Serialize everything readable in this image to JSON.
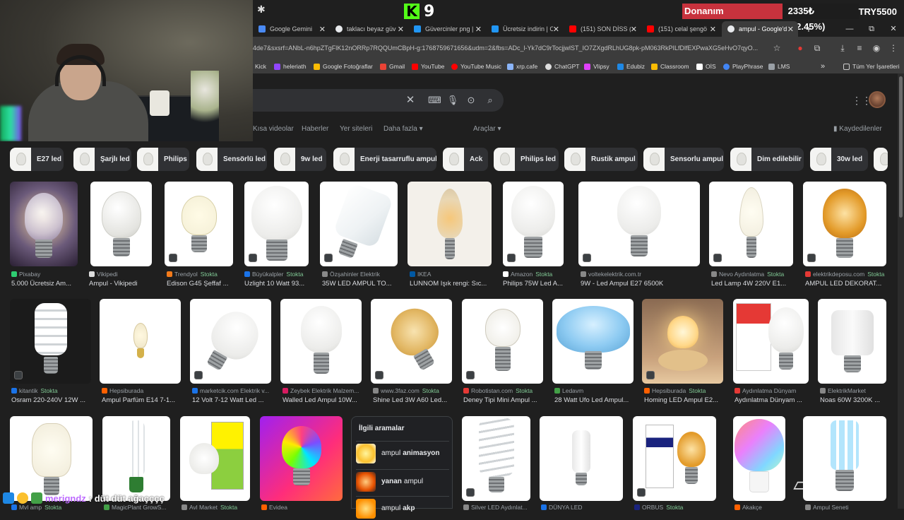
{
  "stream": {
    "kick_count": "9",
    "ticker": {
      "name": "Donanım",
      "change": "2335₺ (42.45%)",
      "price": "TRY5500"
    },
    "chat": {
      "user": "merigndz",
      "message": ": düt düt ağaçççç"
    }
  },
  "browser": {
    "tabs": [
      {
        "title": "Google Gemini",
        "color": "#4a8af4"
      },
      {
        "title": "taklacı beyaz güv",
        "color": "#e8eaed"
      },
      {
        "title": "Güvercinler png |",
        "color": "#2196f3"
      },
      {
        "title": "Ücretsiz indirin | C",
        "color": "#2196f3"
      },
      {
        "title": "(151) SON DİSS (",
        "color": "#ff0000"
      },
      {
        "title": "(151) celal şengö",
        "color": "#ff0000"
      },
      {
        "title": "ampul - Google'd",
        "color": "#e8eaed"
      }
    ],
    "new_tab": "+",
    "window_controls": [
      "⌄",
      "—",
      "⧉",
      "✕"
    ],
    "url": "4de7&sxsrf=ANbL-n6hpZTgFlK12nORRp7RQQUmCBpH-g:1768759671656&udm=2&fbs=ADc_l-Yk7dC9rTocjjwlST_IO7ZXgdRLhUG8pk-pM063RkPILfDlfEXPwaXG5eHvO7qyO...",
    "bookmarks": [
      {
        "label": "Kick",
        "color": "#53fc18"
      },
      {
        "label": "heleriath",
        "color": "#9146ff"
      },
      {
        "label": "Google Fotoğraflar",
        "color": "#fbbc04"
      },
      {
        "label": "Gmail",
        "color": "#ea4335"
      },
      {
        "label": "YouTube",
        "color": "#ff0000"
      },
      {
        "label": "YouTube Music",
        "color": "#ff0000"
      },
      {
        "label": "xrp.cafe",
        "color": "#8ab4f8"
      },
      {
        "label": "ChatGPT",
        "color": "#dddddd"
      },
      {
        "label": "Vlipsy",
        "color": "#e040fb"
      },
      {
        "label": "Edubiz",
        "color": "#1e88e5"
      },
      {
        "label": "Classroom",
        "color": "#fbbc04"
      },
      {
        "label": "OİS",
        "color": "#ffffff"
      },
      {
        "label": "PlayPhrase",
        "color": "#4285f4"
      },
      {
        "label": "LMS",
        "color": "#9aa0a6"
      }
    ],
    "bookmarks_more": "»",
    "all_bookmarks": "Tüm Yer İşaretleri"
  },
  "google": {
    "search_tabs": [
      "Kısa videolar",
      "Haberler",
      "Yer siteleri",
      "Daha fazla ▾",
      "Araçlar ▾"
    ],
    "saved": "Kaydedilenler",
    "chips": [
      "E27 led",
      "Şarjlı led",
      "Philips",
      "Sensörlü led",
      "9w led",
      "Enerji tasarruflu ampul",
      "Ack",
      "Philips led",
      "Rustik ampul",
      "Sensorlu ampul",
      "Dim edilebilir",
      "30w led"
    ],
    "row1": [
      {
        "source": "Pixabay",
        "stock": "",
        "caption": "5.000 Ücretsiz Am...",
        "fav": "#2ecc71"
      },
      {
        "source": "Vikipedi",
        "stock": "",
        "caption": "Ampul - Vikipedi",
        "fav": "#dddddd"
      },
      {
        "source": "Trendyol",
        "stock": "Stokta",
        "caption": "Edison G45 Şeffaf ...",
        "fav": "#f27a1a"
      },
      {
        "source": "Büyükalpler",
        "stock": "Stokta",
        "caption": "Uzlight 10 Watt 93...",
        "fav": "#1a73e8"
      },
      {
        "source": "Özşahinler Elektrik",
        "stock": "",
        "caption": "35W LED AMPUL TO...",
        "fav": "#888888"
      },
      {
        "source": "IKEA",
        "stock": "",
        "caption": "LUNNOM Işık rengi: Sıc...",
        "fav": "#0058a3"
      },
      {
        "source": "Amazon",
        "stock": "Stokta",
        "caption": "Philips 75W Led A...",
        "fav": "#ffffff"
      },
      {
        "source": "voltekelektrik.com.tr",
        "stock": "",
        "caption": "9W - Led Ampul E27 6500K",
        "fav": "#888888"
      },
      {
        "source": "Nevo Aydınlatma",
        "stock": "Stokta",
        "caption": "Led Lamp 4W 220V E1...",
        "fav": "#888888"
      },
      {
        "source": "elektrikdeposu.com",
        "stock": "Stokta",
        "caption": "AMPUL LED DEKORAT...",
        "fav": "#e53935"
      }
    ],
    "row2": [
      {
        "source": "kitantik",
        "stock": "Stokta",
        "caption": "Osram 220-240V 12W ...",
        "fav": "#1a73e8"
      },
      {
        "source": "Hepsiburada",
        "stock": "",
        "caption": "Ampul Parfüm E14 7-1...",
        "fav": "#ff6000"
      },
      {
        "source": "marketcik.com Elektrik v...",
        "stock": "",
        "caption": "12 Volt 7-12 Watt Led ...",
        "fav": "#1a73e8"
      },
      {
        "source": "Zeybek Elektrik Malzem...",
        "stock": "",
        "caption": "Walled Led Ampul 10W...",
        "fav": "#d81b60"
      },
      {
        "source": "www.3faz.com",
        "stock": "Stokta",
        "caption": "Shine Led 3W A60 Led...",
        "fav": "#888888"
      },
      {
        "source": "Robotistan.com",
        "stock": "Stokta",
        "caption": "Deney Tipi Mini Ampul ...",
        "fav": "#e53935"
      },
      {
        "source": "Ledavm",
        "stock": "",
        "caption": "28 Watt Ufo Led Ampul...",
        "fav": "#43a047"
      },
      {
        "source": "Hepsiburada",
        "stock": "Stokta",
        "caption": "Homing LED Ampul E2...",
        "fav": "#ff6000"
      },
      {
        "source": "Aydınlatma Dünyam",
        "stock": "",
        "caption": "Aydınlatma Dünyam ...",
        "fav": "#e53935"
      },
      {
        "source": "ElektrikMarket",
        "stock": "",
        "caption": "Noas 60W 3200K ...",
        "fav": "#888888"
      }
    ],
    "row3": [
      {
        "source": "Mvl amp",
        "stock": "Stokta"
      },
      {
        "source": "MagicPlant GrowS...",
        "stock": ""
      },
      {
        "source": "Avl Market",
        "stock": "Stokta"
      },
      {
        "source": "Evidea",
        "stock": ""
      },
      {
        "source": "Silver LED Aydınlat...",
        "stock": ""
      },
      {
        "source": "DÜNYA LED",
        "stock": ""
      },
      {
        "source": "ORBUS",
        "stock": "Stokta"
      },
      {
        "source": "Akakçe",
        "stock": ""
      },
      {
        "source": "Ampul Seneti",
        "stock": ""
      }
    ],
    "related": {
      "title": "İlgili aramalar",
      "items": [
        {
          "pre": "ampul",
          "bold": "animasyon"
        },
        {
          "pre": "",
          "bold": "yanan",
          "post": "ampul"
        },
        {
          "pre": "ampul",
          "bold": "akp"
        }
      ]
    }
  }
}
